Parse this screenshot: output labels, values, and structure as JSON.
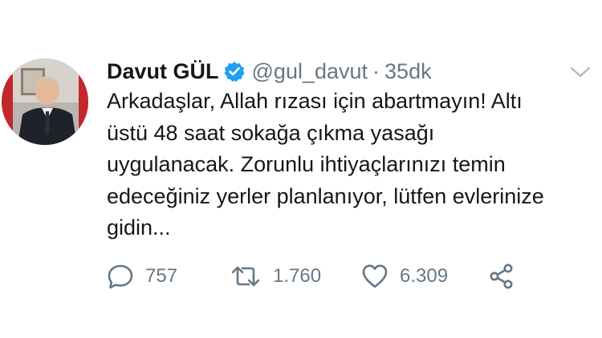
{
  "tweet": {
    "author_name": "Davut GÜL",
    "handle": "@gul_davut",
    "separator": "·",
    "time": "35dk",
    "text_lines": [
      "Arkadaşlar, Allah rızası için abartmayın! Altı",
      "üstü 48 saat sokağa çıkma yasağı",
      "uygulanacak. Zorunlu ihtiyaçlarınızı temin",
      "edeceğiniz yerler planlanıyor, lütfen evlerinize",
      "gidin..."
    ],
    "reply_count": "757",
    "retweet_count": "1.760",
    "like_count": "6.309"
  },
  "icons": {
    "verified": "verified-badge-icon",
    "caret": "chevron-down-icon",
    "reply": "reply-icon",
    "retweet": "retweet-icon",
    "like": "heart-icon",
    "share": "share-icon"
  },
  "colors": {
    "verified_blue": "#1da1f2",
    "muted_text": "#657786",
    "primary_text": "#14171a"
  }
}
